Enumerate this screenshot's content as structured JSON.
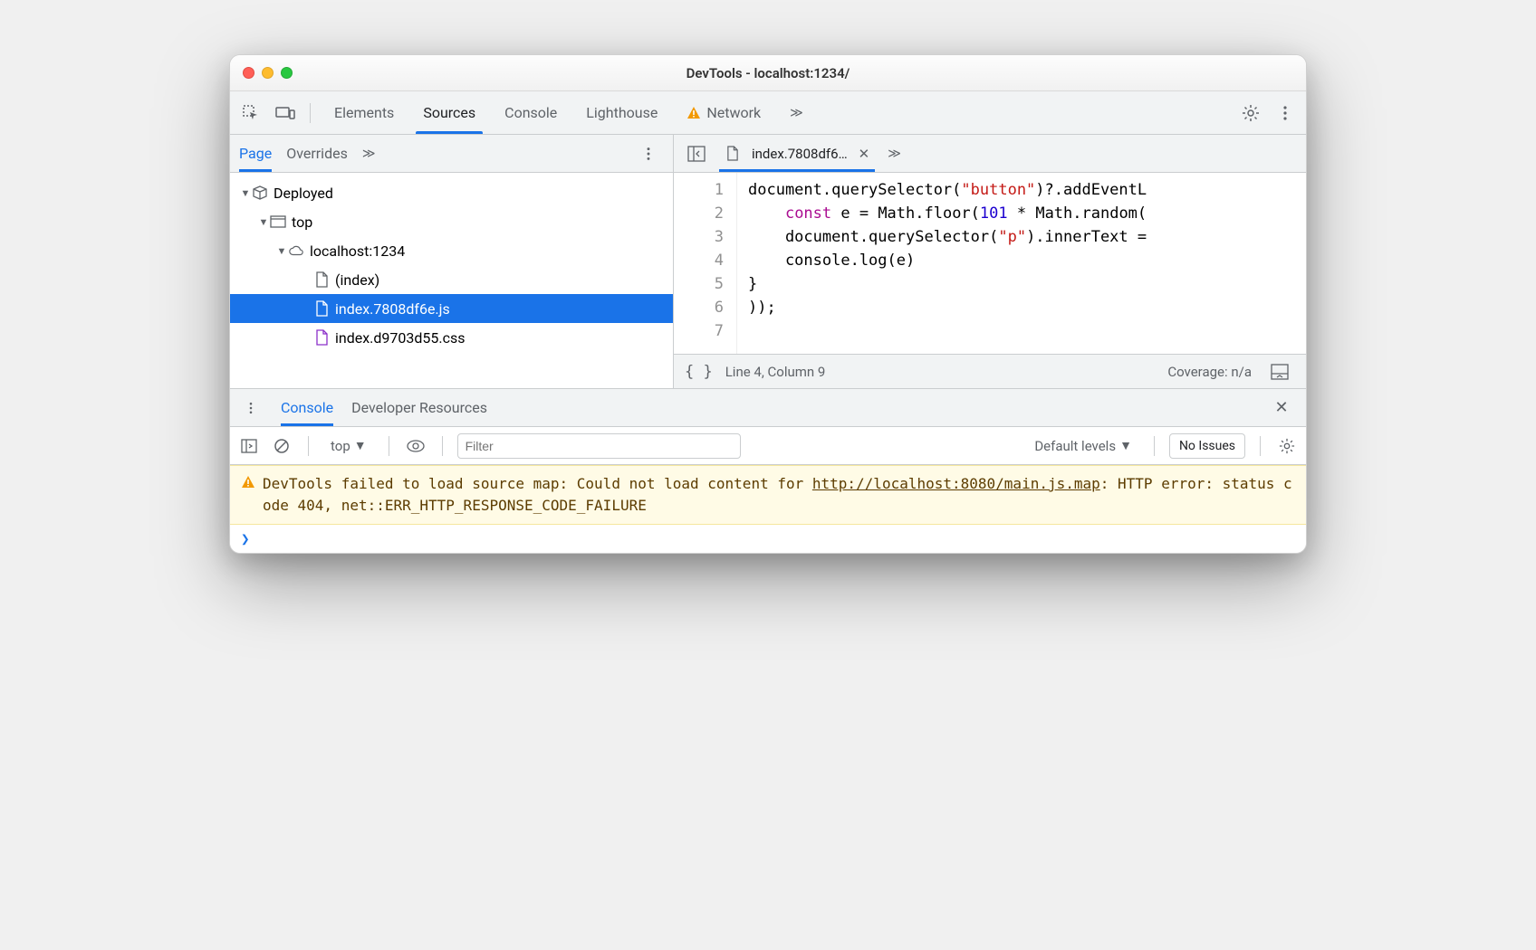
{
  "window": {
    "title": "DevTools - localhost:1234/"
  },
  "toolbar": {
    "tabs": [
      "Elements",
      "Sources",
      "Console",
      "Lighthouse",
      "Network"
    ],
    "activeTab": "Sources",
    "networkHasWarning": true
  },
  "sourcesSubtabs": {
    "items": [
      "Page",
      "Overrides"
    ],
    "active": "Page"
  },
  "tree": {
    "root": "Deployed",
    "top": "top",
    "origin": "localhost:1234",
    "files": [
      {
        "name": "(index)",
        "kind": "html"
      },
      {
        "name": "index.7808df6e.js",
        "kind": "js",
        "selected": true
      },
      {
        "name": "index.d9703d55.css",
        "kind": "css"
      }
    ]
  },
  "openFile": {
    "tabLabel": "index.7808df6…",
    "lines": [
      {
        "n": 1,
        "html": "document.querySelector(<span class='str'>\"button\"</span>)?.addEventL"
      },
      {
        "n": 2,
        "html": "    <span class='kw'>const</span> e = Math.floor(<span class='num'>101</span> * Math.random("
      },
      {
        "n": 3,
        "html": "    document.querySelector(<span class='str'>\"p\"</span>).innerText ="
      },
      {
        "n": 4,
        "html": "    console.log(e)"
      },
      {
        "n": 5,
        "html": "}"
      },
      {
        "n": 6,
        "html": "));"
      },
      {
        "n": 7,
        "html": ""
      }
    ]
  },
  "statusbar": {
    "position": "Line 4, Column 9",
    "coverage": "Coverage: n/a"
  },
  "drawer": {
    "tabs": [
      "Console",
      "Developer Resources"
    ],
    "active": "Console",
    "context": "top",
    "filterPlaceholder": "Filter",
    "levels": "Default levels",
    "issues": "No Issues"
  },
  "consoleWarning": {
    "prefix": "DevTools failed to load source map: Could not load content for ",
    "link": "http://localhost:8080/main.js.map",
    "suffix": ": HTTP error: status code 404, net::ERR_HTTP_RESPONSE_CODE_FAILURE"
  }
}
